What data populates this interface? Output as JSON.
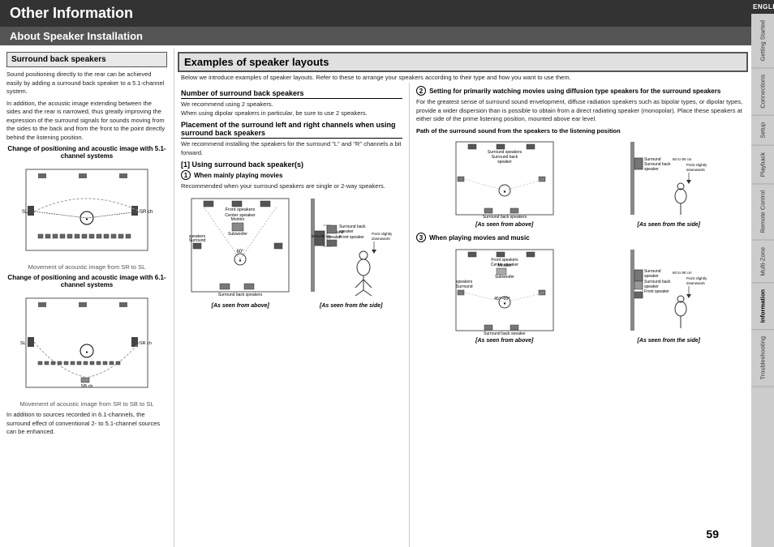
{
  "header": {
    "title": "Other Information",
    "section": "About Speaker Installation",
    "page_number": "59"
  },
  "tabs": {
    "english": "ENGLISH",
    "items": [
      "Getting Started",
      "Connections",
      "Setup",
      "Playback",
      "Remote Control",
      "Multi-Zone",
      "Information",
      "Troubleshooting"
    ]
  },
  "left_col": {
    "surround_title": "Surround back speakers",
    "para1": "Sound positioning directly to the rear can be achieved easily by adding a surround back speaker to a 5.1-channel system.",
    "para2": "In addition, the acoustic image extending between the sides and the rear is narrowed, thus greatly improving the expression of the surround signals for sounds moving from the sides to the back and from the front to the point directly behind the listening position.",
    "diag1_title": "Change of positioning and acoustic image with 5.1-channel systems",
    "diag1_caption": "Movement of acoustic image from SR to SL",
    "diag2_title": "Change of positioning and acoustic image with 6.1-channel systems",
    "diag2_caption": "Movement of acoustic image from SR to SB to SL",
    "para3": "In addition to sources recorded in 6.1-channels, the surround effect of conventional 2- to 5.1-channel sources can be enhanced."
  },
  "examples_box": {
    "title": "Examples of speaker layouts",
    "intro": "Below we introduce examples of speaker layouts. Refer to these to arrange your speakers according to their type and how you want to use them."
  },
  "middle_col": {
    "num_speakers_title": "Number of surround back speakers",
    "num_speakers_text": "We recommend using 2 speakers.\nWhen using dipolar speakers in particular, be sure to use 2 speakers.",
    "placement_title": "Placement of the surround left and right channels when using surround back speakers",
    "placement_text": "We recommend installing the speakers for the surround \"L\" and \"R\" channels a bit forward.",
    "sub1_title": "[1] Using surround back speaker(s)",
    "circle1": "①",
    "when_movies_title": "When mainly playing movies",
    "when_movies_text": "Recommended when your surround speakers are single or 2-way speakers.",
    "labels": {
      "front_speakers_center": "Front speakers Center speaker",
      "monitor_subwoofer": "Monitor Subwoofer",
      "surround_speakers": "Surround speakers",
      "surround_back_speakers": "Surround back speakers",
      "surround_speaker": "Surround speaker",
      "surround_back_speaker": "Surround back speaker",
      "front_speaker": "Front speaker",
      "60_to_90_cm": "60 to 90 cm",
      "point_slightly_downwards": "Point slightly downwards",
      "60deg": "60°",
      "as_seen_above": "[As seen from above]",
      "as_seen_side": "[As seen from the side]"
    }
  },
  "right_col": {
    "circle2": "②",
    "setting_title": "Setting for primarily watching movies using diffusion type speakers for the surround speakers",
    "setting_text": "For the greatest sense of surround sound envelopment, diffuse radiation speakers such as bipolar types, or dipolar types, provide a wider dispersion than is possible to obtain from a direct radiating speaker (monopolar). Place these speakers at either side of the prime listening position, mounted above ear level.",
    "path_label": "Path of the surround sound from the speakers to the listening position",
    "circle3": "③",
    "playing_movies_music_title": "When playing movies and music",
    "labels": {
      "front_speakers_center": "Front speakers Center speaker",
      "monitor_subwoofer": "Monitor Subwoofer",
      "surround_speaker": "Surround speaker",
      "surround_back_speaker": "Surround back speaker",
      "front_speaker": "Front speaker",
      "surround_back_speakers": "Surround back speakers",
      "surround_back_speaker2": "Surround back speaker",
      "60_to_90_cm": "60 to 90 cm",
      "45_60_deg": "45° – 60°",
      "point_slightly_downwards": "Point slightly downwards",
      "as_seen_above": "[As seen from above]",
      "as_seen_side": "[As seen from the side]"
    }
  }
}
